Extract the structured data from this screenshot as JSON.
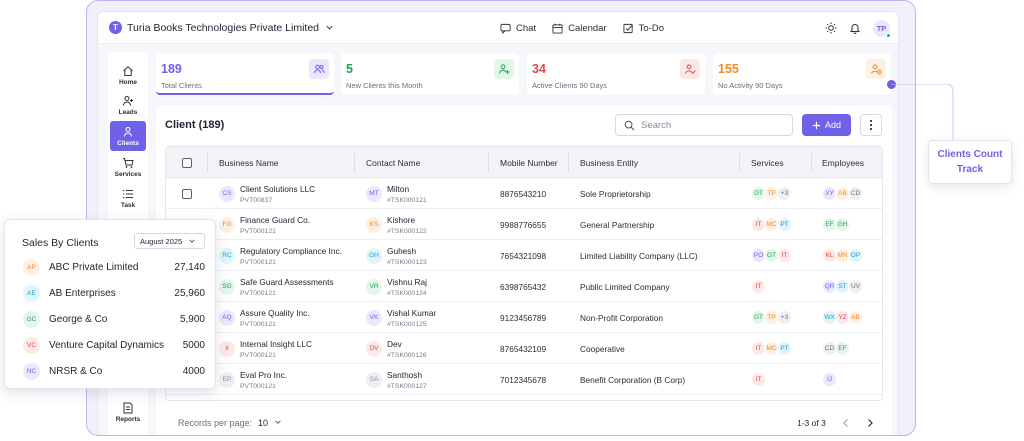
{
  "topbar": {
    "org_initial": "T",
    "org_name": "Turia Books Technologies Private Limited",
    "nav": [
      {
        "label": "Chat",
        "icon": "chat-icon"
      },
      {
        "label": "Calendar",
        "icon": "calendar-icon"
      },
      {
        "label": "To-Do",
        "icon": "todo-icon"
      }
    ],
    "user_initials": "TP"
  },
  "sidebar": {
    "items": [
      {
        "label": "Home",
        "icon": "home-icon"
      },
      {
        "label": "Leads",
        "icon": "leads-icon"
      },
      {
        "label": "Clients",
        "icon": "clients-icon",
        "active": true
      },
      {
        "label": "Services",
        "icon": "cart-icon"
      },
      {
        "label": "Task",
        "icon": "task-icon"
      },
      {
        "label": "Reports",
        "icon": "reports-icon"
      }
    ]
  },
  "stats": [
    {
      "value": "189",
      "caption": "Total Clients",
      "color": "#6f61e8",
      "bg": "#ebe8fd"
    },
    {
      "value": "5",
      "caption": "New Clients this Month",
      "color": "#22a455",
      "bg": "#e3f6ea"
    },
    {
      "value": "34",
      "caption": "Active Clients 90 Days",
      "color": "#e0474c",
      "bg": "#fde8e8"
    },
    {
      "value": "155",
      "caption": "No Activity 90 Days",
      "color": "#f08a24",
      "bg": "#fef0e2"
    }
  ],
  "client_panel": {
    "title": "Client (189)",
    "search_placeholder": "Search",
    "add_label": "Add",
    "columns": [
      "Business Name",
      "Contact Name",
      "Mobile Number",
      "Business Entity",
      "Services",
      "Employees"
    ],
    "rows": [
      {
        "bi": "CS",
        "bc": "#6f61e8",
        "bbg": "#ebe8fd",
        "business": "Client Solutions LLC",
        "bid": "PVT00837",
        "ci": "MT",
        "cc": "#6f61e8",
        "cbg": "#ebe8fd",
        "contact": "Milton",
        "cid": "#TSK000121",
        "mobile": "8876543210",
        "entity": "Sole Proprietorship",
        "services": [
          "GT",
          "TP",
          "+3"
        ],
        "employees": [
          "XY",
          "AB",
          "CD"
        ]
      },
      {
        "bi": "FG",
        "bc": "#f08a24",
        "bbg": "#fef0e2",
        "business": "Finance Guard Co.",
        "bid": "PVT000121",
        "ci": "KS",
        "cc": "#f08a24",
        "cbg": "#fef0e2",
        "contact": "Kishore",
        "cid": "#TSK000122",
        "mobile": "9988776655",
        "entity": "General Partnership",
        "services": [
          "IT",
          "MC",
          "PT"
        ],
        "employees": [
          "EF",
          "GH"
        ]
      },
      {
        "bi": "RC",
        "bc": "#1aa0c8",
        "bbg": "#e1f4fa",
        "business": "Regulatory Compliance Inc.",
        "bid": "PVT000121",
        "ci": "GH",
        "cc": "#1aa0c8",
        "cbg": "#e1f4fa",
        "contact": "Guhesh",
        "cid": "#TSK000123",
        "mobile": "7654321098",
        "entity": "Limited Liability Company (LLC)",
        "services": [
          "PO",
          "GT",
          "IT"
        ],
        "employees": [
          "KL",
          "MN",
          "OP"
        ]
      },
      {
        "bi": "SG",
        "bc": "#22a455",
        "bbg": "#e3f6ea",
        "business": "Safe Guard Assessments",
        "bid": "PVT000121",
        "ci": "VR",
        "cc": "#22a455",
        "cbg": "#e3f6ea",
        "contact": "Vishnu Raj",
        "cid": "#TSK000124",
        "mobile": "6398765432",
        "entity": "Public Limited Company",
        "services": [
          "IT"
        ],
        "employees": [
          "QR",
          "ST",
          "UV"
        ]
      },
      {
        "bi": "AQ",
        "bc": "#6f61e8",
        "bbg": "#ebe8fd",
        "business": "Assure Quality Inc.",
        "bid": "PVT000121",
        "ci": "VK",
        "cc": "#6f61e8",
        "cbg": "#ebe8fd",
        "contact": "Vishal Kumar",
        "cid": "#TSK000125",
        "mobile": "9123456789",
        "entity": "Non-Profit Corporation",
        "services": [
          "GT",
          "TP",
          "+3"
        ],
        "employees": [
          "WX",
          "YZ",
          "AB"
        ]
      },
      {
        "bi": "II",
        "bc": "#e0474c",
        "bbg": "#fde8e8",
        "business": "Internal Insight LLC",
        "bid": "PVT000121",
        "ci": "DV",
        "cc": "#e0474c",
        "cbg": "#fde8e8",
        "contact": "Dev",
        "cid": "#TSK000126",
        "mobile": "8765432109",
        "entity": "Cooperative",
        "services": [
          "IT",
          "MC",
          "PT"
        ],
        "employees": [
          "CD",
          "EF"
        ]
      },
      {
        "bi": "EP",
        "bc": "#8a8d99",
        "bbg": "#eeeff3",
        "business": "Eval Pro Inc.",
        "bid": "PVT000121",
        "ci": "SA",
        "cc": "#8a8d99",
        "cbg": "#eeeff3",
        "contact": "Santhosh",
        "cid": "#TSK000127",
        "mobile": "7012345678",
        "entity": "Benefit Corporation (B Corp)",
        "services": [
          "IT"
        ],
        "employees": [
          "IJ"
        ]
      }
    ],
    "footer": {
      "label": "Records per page:",
      "value": "10",
      "range": "1-3 of 3"
    }
  },
  "chip_colors": {
    "GT": [
      "#22a455",
      "#e3f6ea"
    ],
    "TP": [
      "#f08a24",
      "#fef0e2"
    ],
    "+3": [
      "#6b6f80",
      "#eeeff3"
    ],
    "IT": [
      "#e0474c",
      "#fde8e8"
    ],
    "MC": [
      "#f08a24",
      "#fef0e2"
    ],
    "PT": [
      "#1aa0c8",
      "#e1f4fa"
    ],
    "PO": [
      "#6f61e8",
      "#ebe8fd"
    ],
    "XY": [
      "#6f61e8",
      "#ebe8fd"
    ],
    "AB": [
      "#f08a24",
      "#fef0e2"
    ],
    "CD": [
      "#6b6f80",
      "#eeeff3"
    ],
    "EF": [
      "#22a455",
      "#e3f6ea"
    ],
    "GH": [
      "#22a455",
      "#e3f6ea"
    ],
    "KL": [
      "#e0474c",
      "#fde8e8"
    ],
    "MN": [
      "#f08a24",
      "#fef0e2"
    ],
    "OP": [
      "#1aa0c8",
      "#e1f4fa"
    ],
    "QR": [
      "#6f61e8",
      "#ebe8fd"
    ],
    "ST": [
      "#1aa0c8",
      "#e1f4fa"
    ],
    "UV": [
      "#6b6f80",
      "#eeeff3"
    ],
    "WX": [
      "#1aa0c8",
      "#e1f4fa"
    ],
    "YZ": [
      "#e0474c",
      "#fde8e8"
    ],
    "IJ": [
      "#6f61e8",
      "#ebe8fd"
    ]
  },
  "sales": {
    "title": "Sales By Clients",
    "month": "August 2025",
    "rows": [
      {
        "initials": "AP",
        "name": "ABC Private Limited",
        "amount": "27,140",
        "color": "#f08a24",
        "bg": "#fef0e2"
      },
      {
        "initials": "AE",
        "name": "AB Enterprises",
        "amount": "25,960",
        "color": "#1aa0c8",
        "bg": "#e1f4fa"
      },
      {
        "initials": "GC",
        "name": "George & Co",
        "amount": "5,900",
        "color": "#22a455",
        "bg": "#e3f6ea"
      },
      {
        "initials": "VC",
        "name": "Venture Capital Dynamics",
        "amount": "5000",
        "color": "#e0474c",
        "bg": "#fde8e8"
      },
      {
        "initials": "NC",
        "name": "NRSR & Co",
        "amount": "4000",
        "color": "#6f61e8",
        "bg": "#ebe8fd"
      }
    ]
  },
  "callout": {
    "line1": "Clients Count",
    "line2": "Track"
  }
}
